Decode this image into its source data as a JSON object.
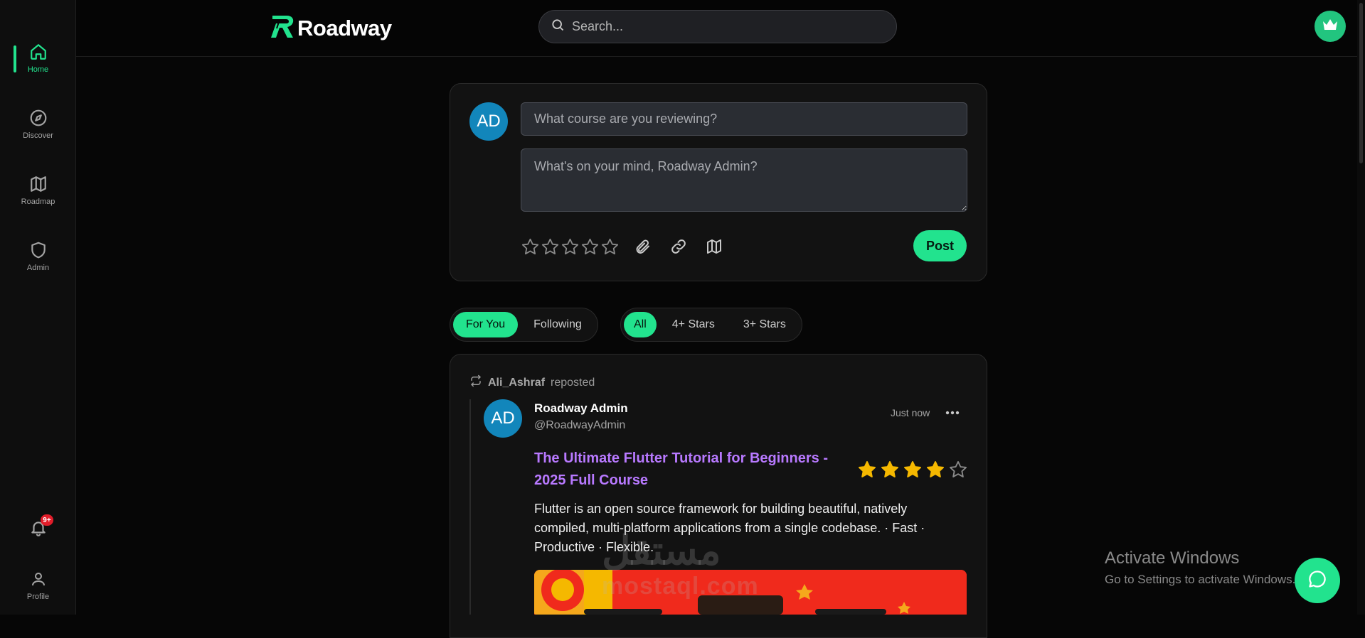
{
  "app": {
    "name": "Roadway"
  },
  "sidebar": {
    "items": [
      {
        "label": "Home",
        "icon": "home-icon",
        "active": true
      },
      {
        "label": "Discover",
        "icon": "compass-icon",
        "active": false
      },
      {
        "label": "Roadmap",
        "icon": "map-icon",
        "active": false
      },
      {
        "label": "Admin",
        "icon": "shield-icon",
        "active": false
      }
    ],
    "notifications": {
      "icon": "bell-icon",
      "badge": "9+"
    },
    "profile": {
      "label": "Profile",
      "icon": "user-icon"
    }
  },
  "header": {
    "search_placeholder": "Search...",
    "crown_icon": "crown-icon"
  },
  "composer": {
    "avatar_initials": "AD",
    "course_placeholder": "What course are you reviewing?",
    "body_placeholder": "What's on your mind, Roadway Admin?",
    "rating": 0,
    "rating_max": 5,
    "tool_icons": [
      "paperclip-icon",
      "link-icon",
      "map-icon"
    ],
    "post_label": "Post"
  },
  "filters": {
    "feed": [
      {
        "label": "For You",
        "active": true
      },
      {
        "label": "Following",
        "active": false
      }
    ],
    "stars": [
      {
        "label": "All",
        "active": true
      },
      {
        "label": "4+ Stars",
        "active": false
      },
      {
        "label": "3+ Stars",
        "active": false
      }
    ]
  },
  "post": {
    "reposted_by": "Ali_Ashraf",
    "reposted_text": "reposted",
    "avatar_initials": "AD",
    "author": "Roadway Admin",
    "handle": "@RoadwayAdmin",
    "time": "Just now",
    "title": "The Ultimate Flutter Tutorial for Beginners - 2025 Full Course",
    "rating": 4,
    "rating_max": 5,
    "body": "Flutter is an open source framework for building beautiful, natively compiled, multi-platform applications from a single codebase. · Fast · Productive · Flexible."
  },
  "overlay": {
    "watermark_ar": "مستقل",
    "watermark_en": "mostaql.com",
    "windows_title": "Activate Windows",
    "windows_sub": "Go to Settings to activate Windows."
  },
  "colors": {
    "accent": "#22e38e",
    "title_purple": "#b879ff",
    "star_gold": "#f5b800",
    "avatar_blue": "#1286bb"
  }
}
